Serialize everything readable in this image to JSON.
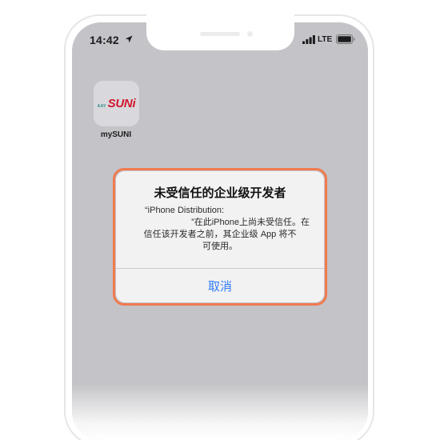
{
  "status_bar": {
    "time": "14:42",
    "network": "LTE"
  },
  "home_screen": {
    "app": {
      "name": "mySUNI",
      "logo_prefix": "AAY",
      "logo_text": "SUNi"
    }
  },
  "alert": {
    "title": "未受信任的企业级开发者",
    "message_lines": [
      "“iPhone Distribution:",
      "”在此iPhone上尚未受信任。在",
      "信任该开发者之前，其企业级 App 将不",
      "可使用。"
    ],
    "cancel_label": "取消"
  },
  "colors": {
    "highlight": "#f07a4f",
    "action_blue": "#2f7cf6",
    "brand_red": "#d1172e"
  }
}
